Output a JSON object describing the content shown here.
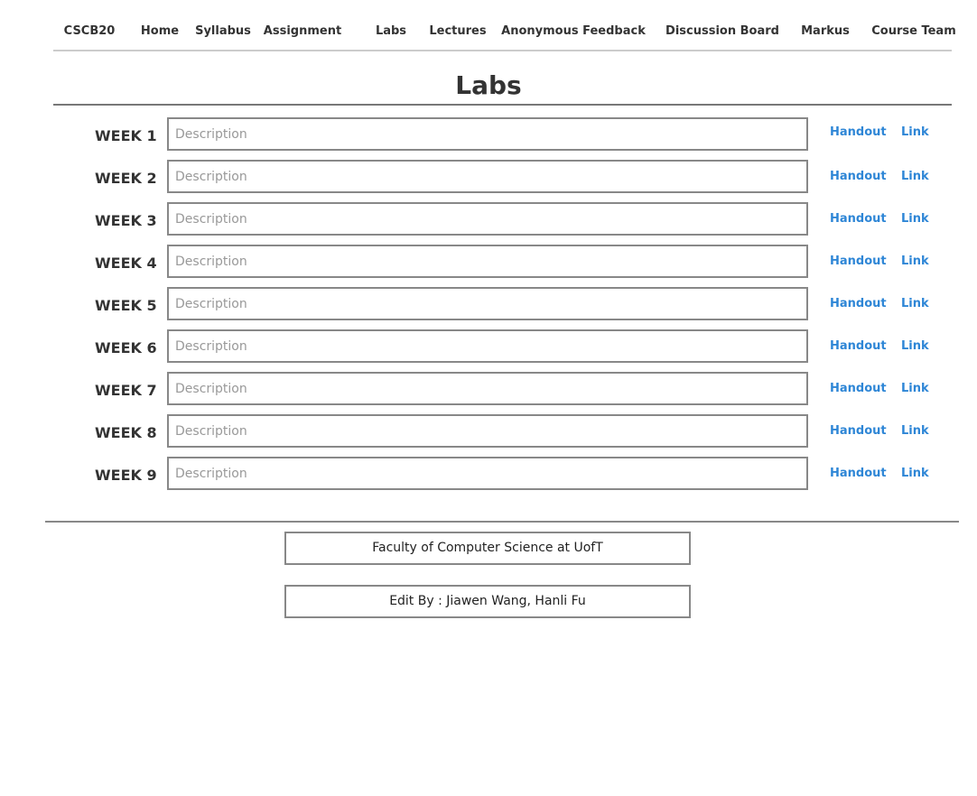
{
  "nav": {
    "items": [
      {
        "label": "CSCB20"
      },
      {
        "label": "Home"
      },
      {
        "label": "Syllabus"
      },
      {
        "label": "Assignment"
      },
      {
        "label": "Labs"
      },
      {
        "label": "Lectures"
      },
      {
        "label": "Anonymous Feedback"
      },
      {
        "label": "Discussion Board"
      },
      {
        "label": "Markus"
      },
      {
        "label": "Course Team"
      }
    ]
  },
  "page": {
    "title": "Labs"
  },
  "weeks": [
    {
      "label": "WEEK 1",
      "placeholder": "Description",
      "handout": "Handout",
      "link": "Link"
    },
    {
      "label": "WEEK 2",
      "placeholder": "Description",
      "handout": "Handout",
      "link": "Link"
    },
    {
      "label": "WEEK 3",
      "placeholder": "Description",
      "handout": "Handout",
      "link": "Link"
    },
    {
      "label": "WEEK 4",
      "placeholder": "Description",
      "handout": "Handout",
      "link": "Link"
    },
    {
      "label": "WEEK 5",
      "placeholder": "Description",
      "handout": "Handout",
      "link": "Link"
    },
    {
      "label": "WEEK 6",
      "placeholder": "Description",
      "handout": "Handout",
      "link": "Link"
    },
    {
      "label": "WEEK 7",
      "placeholder": "Description",
      "handout": "Handout",
      "link": "Link"
    },
    {
      "label": "WEEK 8",
      "placeholder": "Description",
      "handout": "Handout",
      "link": "Link"
    },
    {
      "label": "WEEK 9",
      "placeholder": "Description",
      "handout": "Handout",
      "link": "Link"
    }
  ],
  "footer": {
    "faculty": "Faculty of Computer Science at UofT",
    "credits": "Edit By : Jiawen Wang, Hanli Fu"
  },
  "colors": {
    "link": "#2e86d6",
    "text": "#333333",
    "border": "#888888"
  }
}
